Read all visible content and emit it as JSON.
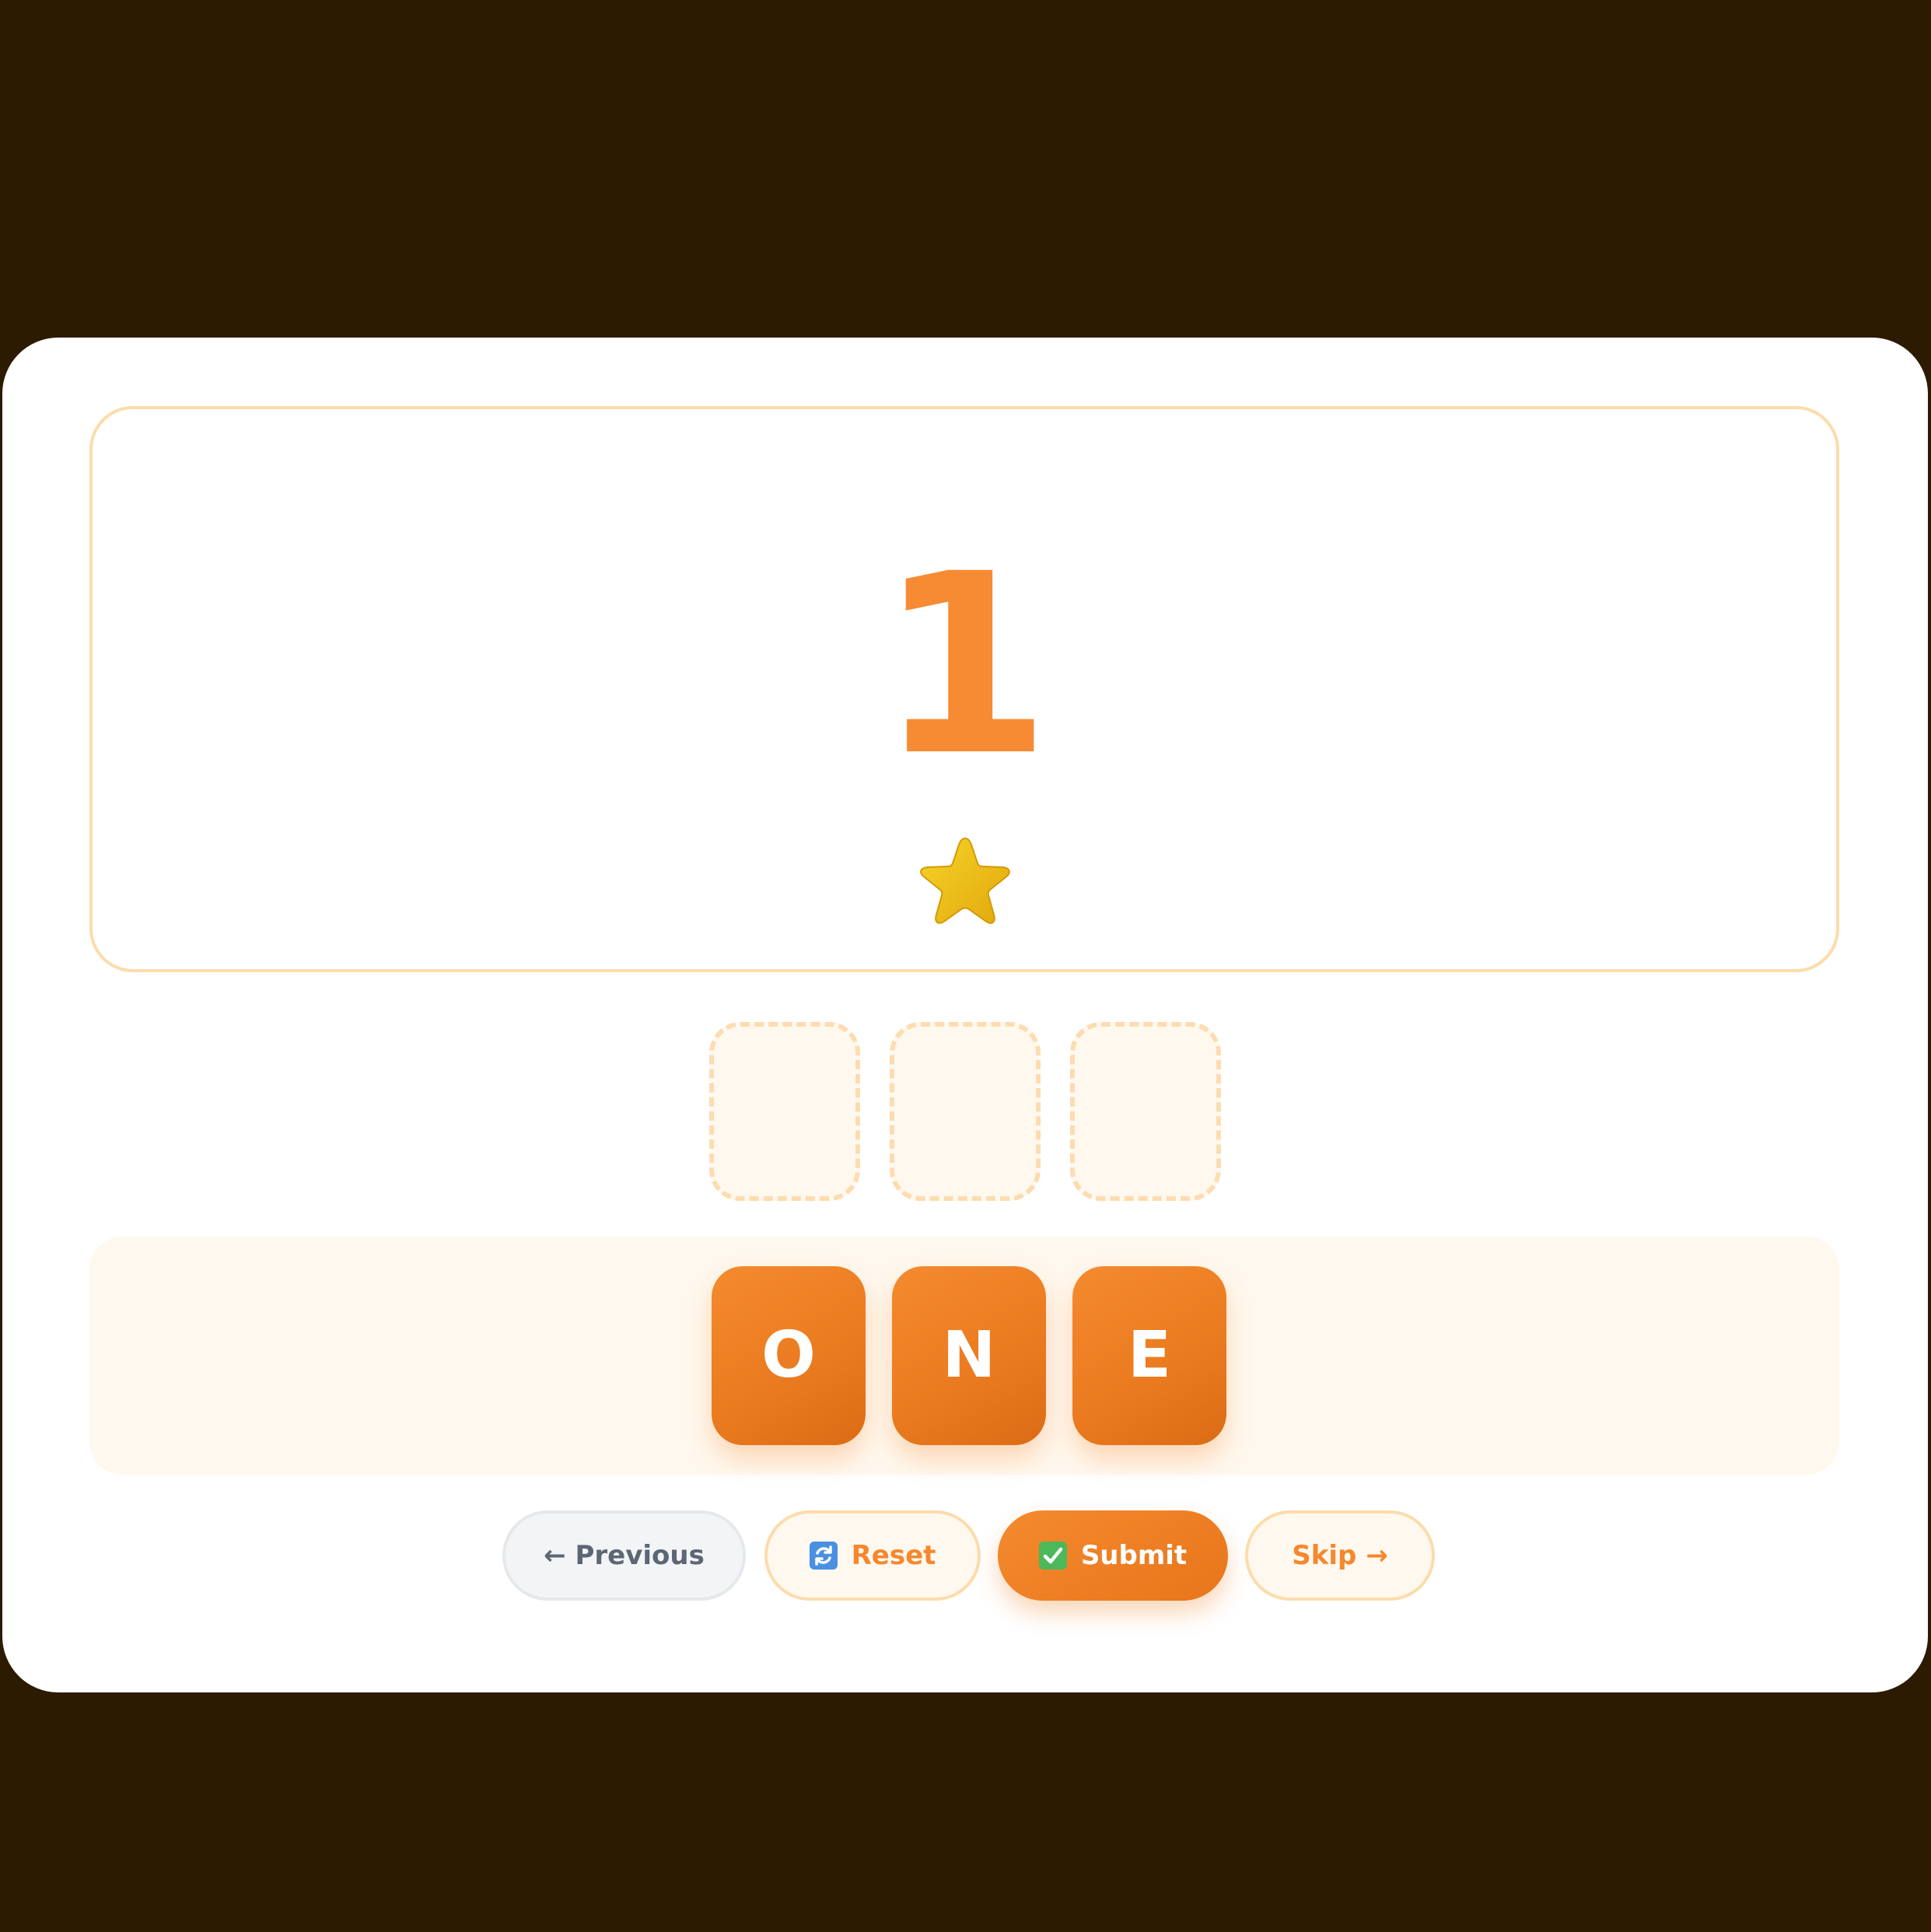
{
  "prompt": {
    "number": "1",
    "counter_icon": "star-icon",
    "star_count": 1
  },
  "answer_slots": [
    "",
    "",
    ""
  ],
  "tiles": [
    {
      "letter": "O"
    },
    {
      "letter": "N"
    },
    {
      "letter": "E"
    }
  ],
  "buttons": {
    "previous_label": "← Previous",
    "reset_label": "Reset",
    "reset_icon": "reset-icon",
    "submit_label": "Submit",
    "submit_icon": "checkmark-icon",
    "skip_label": "Skip →"
  },
  "colors": {
    "background": "#2c1a01",
    "accent": "#f68b33",
    "tile": "#ea7a1f",
    "border": "#fcdcab",
    "star": "#f2c516"
  }
}
